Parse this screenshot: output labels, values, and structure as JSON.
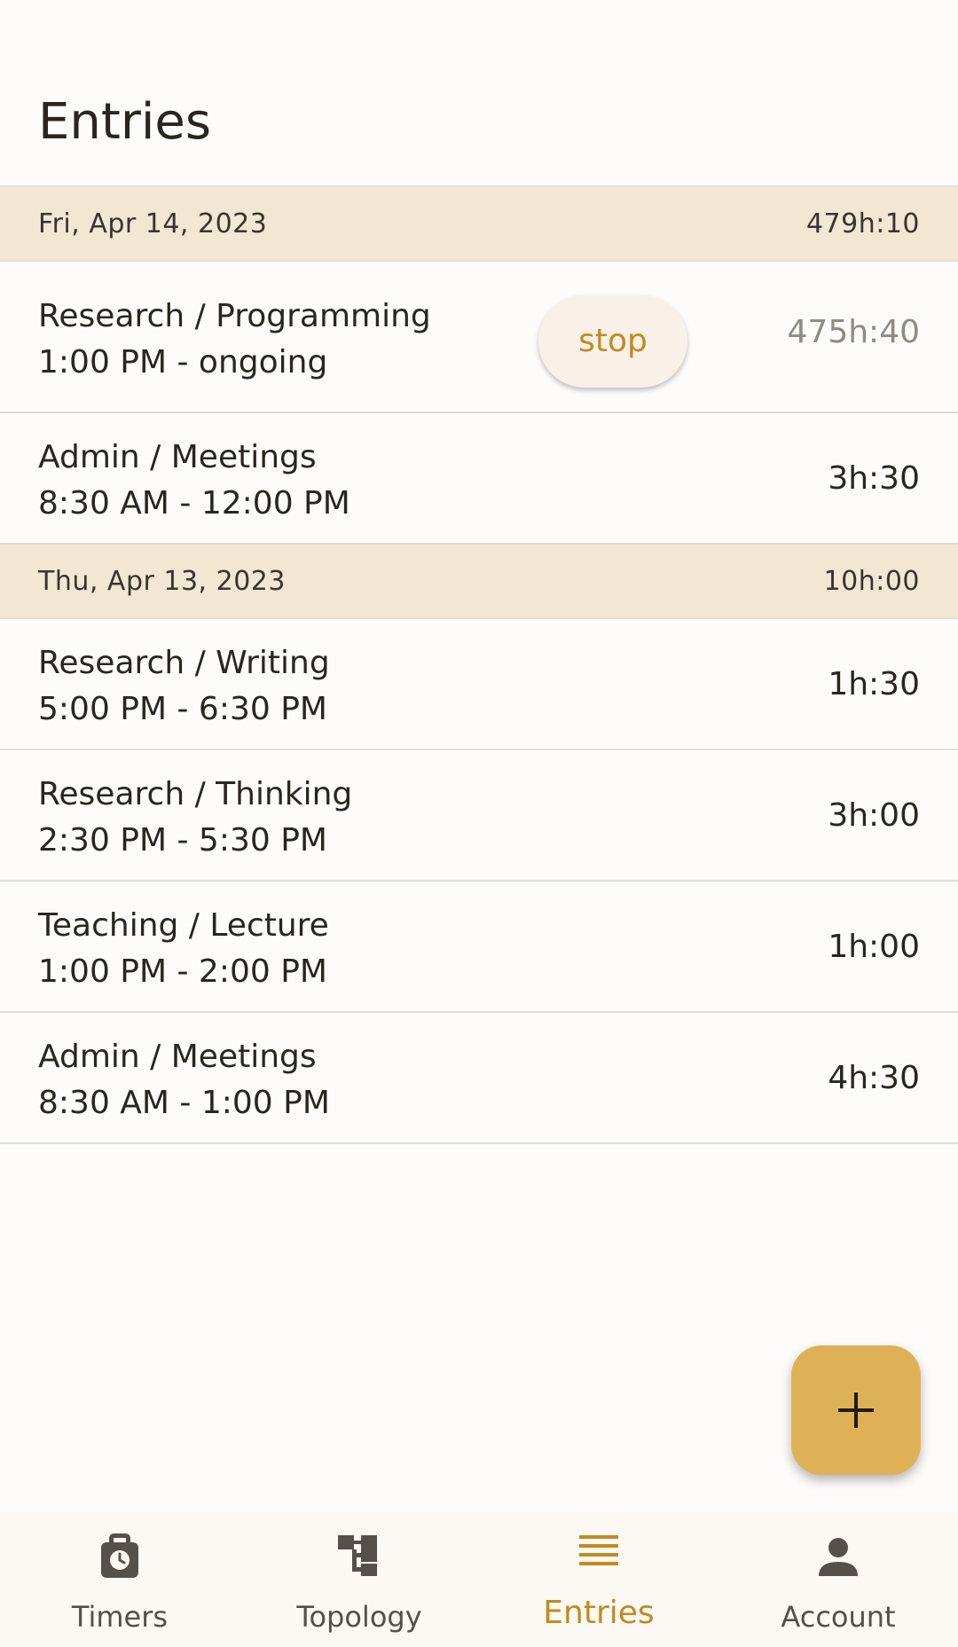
{
  "page": {
    "title": "Entries"
  },
  "days": [
    {
      "date": "Fri, Apr 14, 2023",
      "total": "479h:10",
      "entries": [
        {
          "name": "Research / Programming",
          "time": "1:00 PM - ongoing",
          "duration": "475h:40",
          "action": "stop"
        },
        {
          "name": "Admin / Meetings",
          "time": "8:30 AM - 12:00 PM",
          "duration": "3h:30"
        }
      ]
    },
    {
      "date": "Thu, Apr 13, 2023",
      "total": "10h:00",
      "entries": [
        {
          "name": "Research / Writing",
          "time": "5:00 PM - 6:30 PM",
          "duration": "1h:30"
        },
        {
          "name": "Research / Thinking",
          "time": "2:30 PM - 5:30 PM",
          "duration": "3h:00"
        },
        {
          "name": "Teaching / Lecture",
          "time": "1:00 PM - 2:00 PM",
          "duration": "1h:00"
        },
        {
          "name": "Admin / Meetings",
          "time": "8:30 AM - 1:00 PM",
          "duration": "4h:30"
        }
      ]
    }
  ],
  "fab": {
    "icon": "plus-icon",
    "color": "#dfb156"
  },
  "nav": {
    "active": "entries",
    "active_color": "#c28b1f",
    "items": [
      {
        "label": "Timers",
        "icon": "timer-icon"
      },
      {
        "label": "Topology",
        "icon": "topology-icon"
      },
      {
        "label": "Entries",
        "icon": "list-icon"
      },
      {
        "label": "Account",
        "icon": "person-icon"
      }
    ]
  }
}
